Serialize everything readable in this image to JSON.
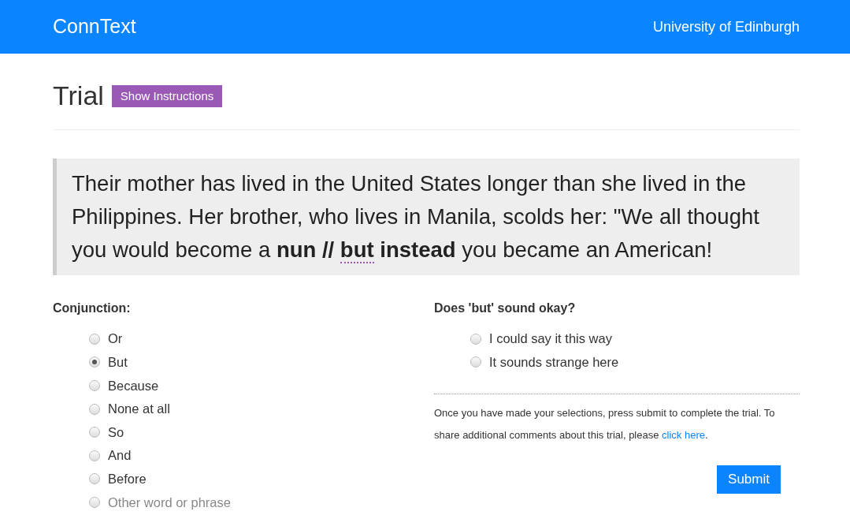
{
  "navbar": {
    "brand": "ConnText",
    "right_link": "University of Edinburgh"
  },
  "heading": {
    "title": "Trial",
    "button": "Show Instructions"
  },
  "passage": [
    {
      "kind": "plain",
      "text": "Their mother has lived in the United States longer than she lived in the Philippines. Her brother, who lives in Manila, scolds her: \"We all thought you would become a "
    },
    {
      "kind": "bold",
      "text": "nun // "
    },
    {
      "kind": "marked",
      "text": "but"
    },
    {
      "kind": "bold",
      "text": " instead"
    },
    {
      "kind": "plain",
      "text": " you became an American!"
    }
  ],
  "conjunction": {
    "label": "Conjunction:",
    "options": [
      {
        "label": "Or",
        "selected": false,
        "disabled": false
      },
      {
        "label": "But",
        "selected": true,
        "disabled": false
      },
      {
        "label": "Because",
        "selected": false,
        "disabled": false
      },
      {
        "label": "None at all",
        "selected": false,
        "disabled": false
      },
      {
        "label": "So",
        "selected": false,
        "disabled": false
      },
      {
        "label": "And",
        "selected": false,
        "disabled": false
      },
      {
        "label": "Before",
        "selected": false,
        "disabled": false
      },
      {
        "label": "Other word or phrase",
        "selected": false,
        "disabled": true
      }
    ]
  },
  "judgement": {
    "label": "Does 'but' sound okay?",
    "options": [
      {
        "label": "I could say it this way",
        "selected": false,
        "disabled": false
      },
      {
        "label": "It sounds strange here",
        "selected": false,
        "disabled": false
      }
    ]
  },
  "note": {
    "text": "Once you have made your selections, press submit to complete the trial. To share additional comments about this trial, please ",
    "link": "click here",
    "end": "."
  },
  "submit": "Submit"
}
